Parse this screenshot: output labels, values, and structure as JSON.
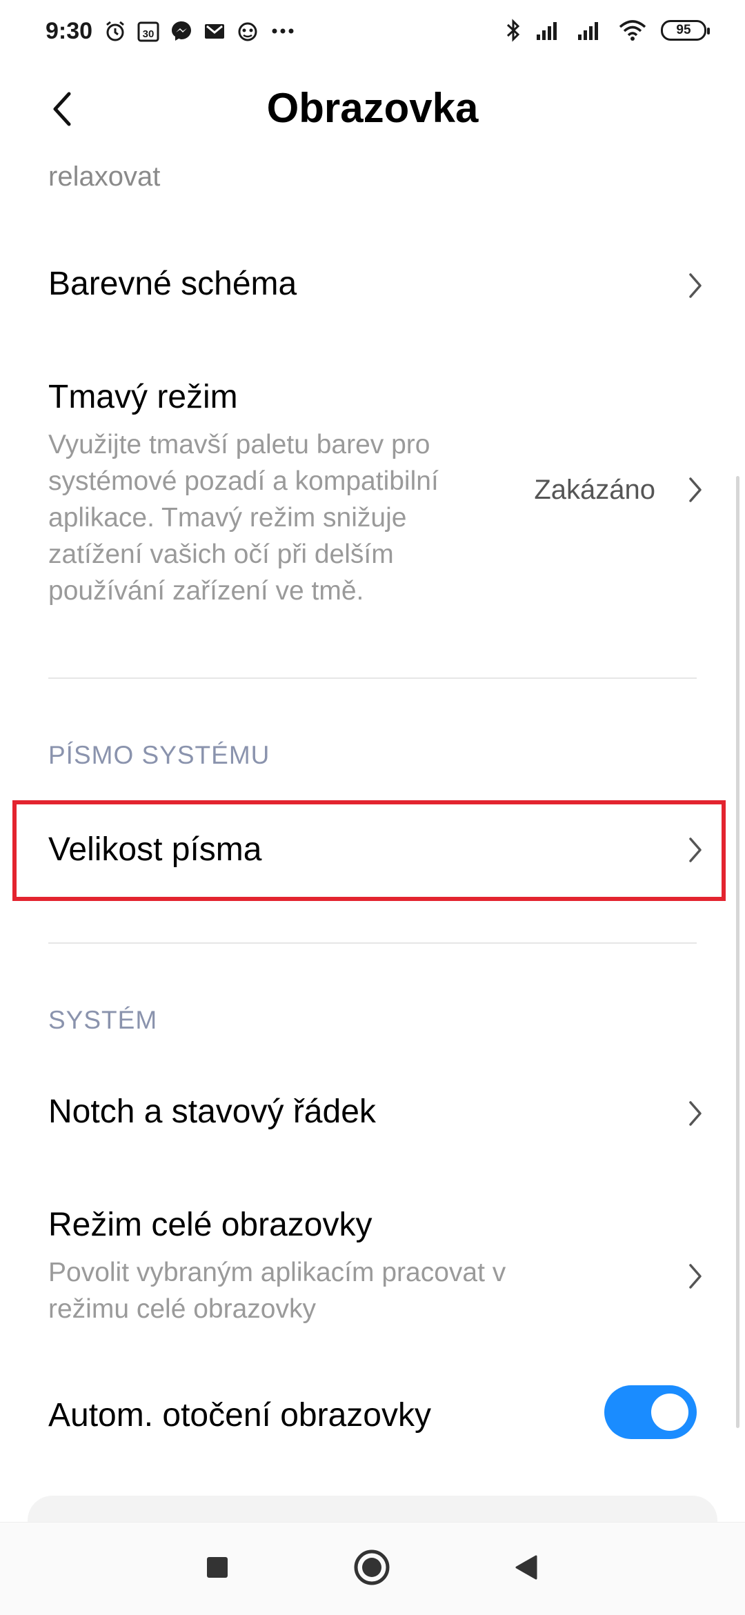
{
  "status_bar": {
    "time": "9:30",
    "left_icons": [
      "alarm-icon",
      "calendar-icon",
      "messenger-icon",
      "gmail-icon",
      "app-icon",
      "more-icon"
    ],
    "calendar_day": "30",
    "battery_level": "95"
  },
  "header": {
    "title": "Obrazovka"
  },
  "content": {
    "partial_text": "relaxovat",
    "color_scheme": {
      "title": "Barevné schéma"
    },
    "dark_mode": {
      "title": "Tmavý režim",
      "subtitle_lines": [
        "Využijte tmavší paletu barev pro",
        "systémové pozadí a kompatibilní",
        "aplikace. Tmavý režim snižuje",
        "zatížení vašich očí při delším",
        "používání zařízení ve tmě."
      ],
      "value": "Zakázáno"
    },
    "section_font": {
      "label": "PÍSMO SYSTÉMU"
    },
    "font_size": {
      "title": "Velikost písma"
    },
    "section_system": {
      "label": "SYSTÉM"
    },
    "notch": {
      "title": "Notch a stavový řádek"
    },
    "fullscreen": {
      "title": "Režim celé obrazovky",
      "subtitle_lines": [
        "Povolit vybraným aplikacím pracovat v",
        "režimu celé obrazovky"
      ]
    },
    "auto_rotate": {
      "title": "Autom. otočení obrazovky",
      "enabled": true
    }
  },
  "colors": {
    "accent": "#1a8cff",
    "highlight": "#e3242f",
    "section_label": "#8a93ad"
  }
}
